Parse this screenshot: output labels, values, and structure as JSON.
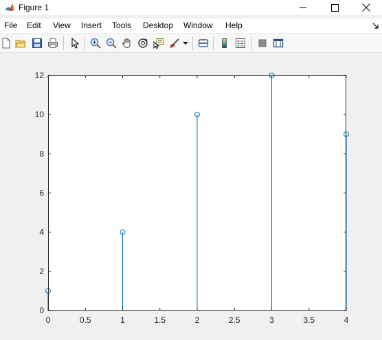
{
  "window": {
    "title": "Figure 1"
  },
  "menu": {
    "items": [
      "File",
      "Edit",
      "View",
      "Insert",
      "Tools",
      "Desktop",
      "Window",
      "Help"
    ]
  },
  "toolbar": {
    "icons": [
      "new-figure-icon",
      "open-file-icon",
      "save-icon",
      "print-icon",
      "pointer-icon",
      "zoom-in-icon",
      "zoom-out-icon",
      "pan-icon",
      "rotate-3d-icon",
      "data-cursor-icon",
      "brush-icon",
      "link-plot-icon",
      "colorbar-icon",
      "legend-icon",
      "hide-plot-tools-icon",
      "show-plot-tools-icon"
    ]
  },
  "colors": {
    "stem": "#0072bd",
    "axes_text": "#262626",
    "axes_line": "#262626",
    "figure_bg": "#f0f0f0",
    "axes_bg": "#ffffff"
  },
  "chart_data": {
    "type": "stem",
    "x": [
      0,
      1,
      2,
      3,
      4
    ],
    "y": [
      1,
      4,
      10,
      12,
      9
    ],
    "xlim": [
      0,
      4
    ],
    "ylim": [
      0,
      12
    ],
    "xticks": [
      "0",
      "0.5",
      "1",
      "1.5",
      "2",
      "2.5",
      "3",
      "3.5",
      "4"
    ],
    "xtick_values": [
      0,
      0.5,
      1,
      1.5,
      2,
      2.5,
      3,
      3.5,
      4
    ],
    "yticks": [
      "0",
      "2",
      "4",
      "6",
      "8",
      "10",
      "12"
    ],
    "ytick_values": [
      0,
      2,
      4,
      6,
      8,
      10,
      12
    ],
    "marker": "open-circle",
    "grid": false,
    "box": true
  }
}
